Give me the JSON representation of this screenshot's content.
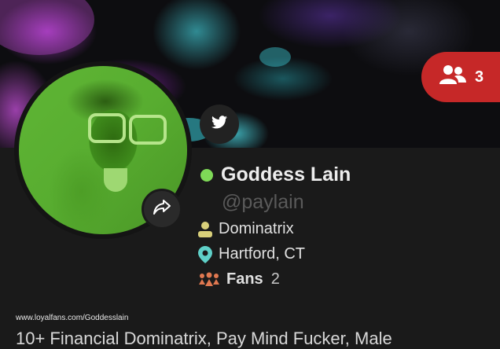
{
  "header": {
    "fans_pill": {
      "icon": "users-icon",
      "count": "3",
      "color": "#c62828"
    }
  },
  "profile": {
    "name": "Goddess Lain",
    "handle": "@paylain",
    "online_color": "#7ed957",
    "category": {
      "icon": "user-icon",
      "text": "Dominatrix"
    },
    "location": {
      "icon": "map-pin-icon",
      "text": "Hartford, CT"
    },
    "fans": {
      "icon": "fans-group-icon",
      "label": "Fans",
      "count": "2"
    }
  },
  "social": {
    "twitter_icon": "twitter-icon"
  },
  "watermark": "www.loyalfans.com/Goddesslain",
  "bio_preview": "10+ Financial Dominatrix, Pay Mind Fucker, Male"
}
